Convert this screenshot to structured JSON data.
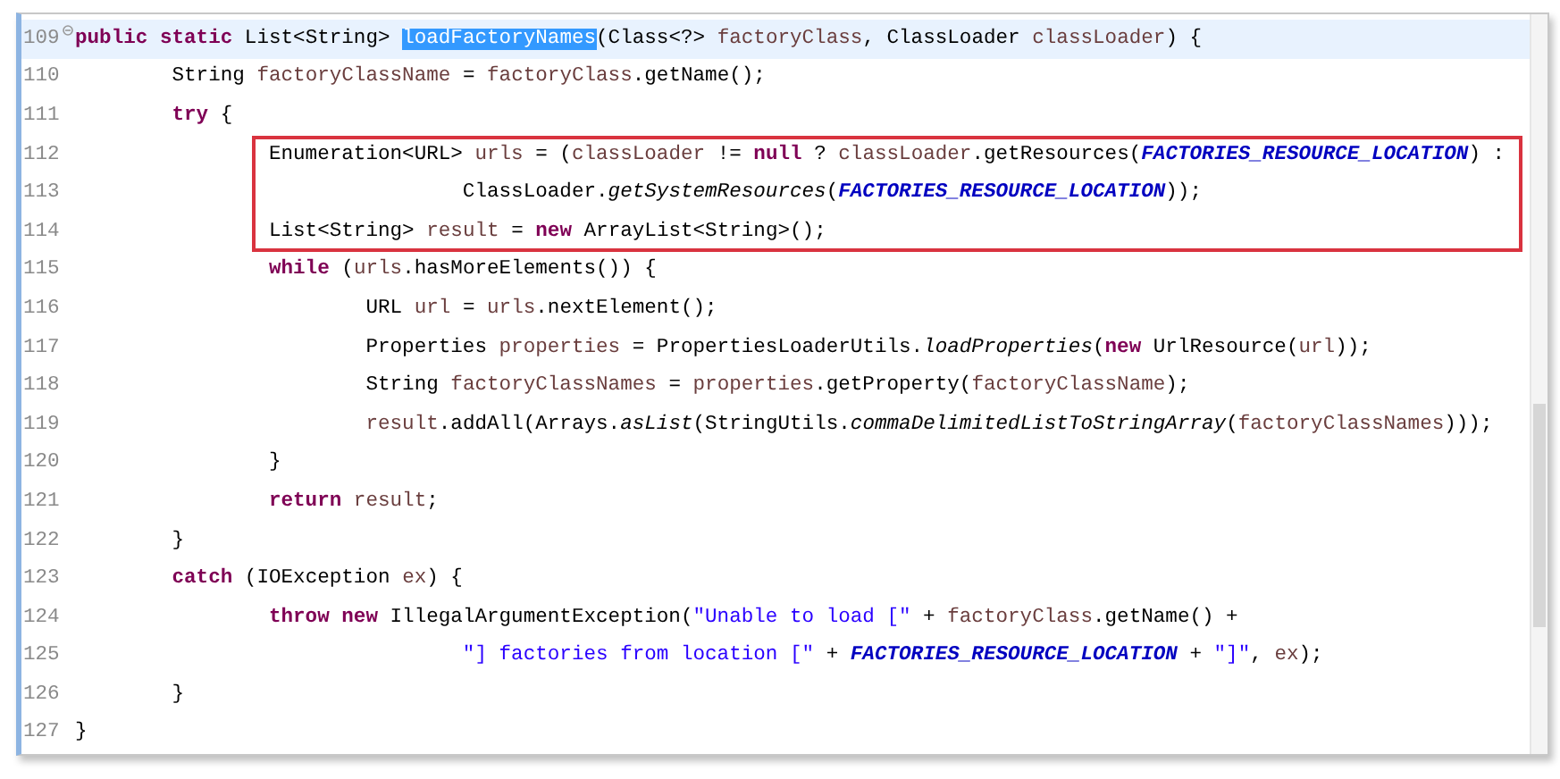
{
  "editor": {
    "lines": [
      {
        "number": "109",
        "current": true,
        "boxed": false,
        "fold": true,
        "tokens": [
          {
            "kind": "keyword",
            "text": "public static"
          },
          {
            "kind": "plain",
            "text": " List<String> "
          },
          {
            "kind": "selection",
            "text": "loadFactoryNames"
          },
          {
            "kind": "plain",
            "text": "(Class<?> "
          },
          {
            "kind": "variable",
            "text": "factoryClass"
          },
          {
            "kind": "plain",
            "text": ", ClassLoader "
          },
          {
            "kind": "variable",
            "text": "classLoader"
          },
          {
            "kind": "plain",
            "text": ") {"
          }
        ]
      },
      {
        "number": "110",
        "current": false,
        "boxed": false,
        "fold": false,
        "tokens": [
          {
            "kind": "plain",
            "text": "        String "
          },
          {
            "kind": "variable",
            "text": "factoryClassName"
          },
          {
            "kind": "plain",
            "text": " = "
          },
          {
            "kind": "variable",
            "text": "factoryClass"
          },
          {
            "kind": "plain",
            "text": ".getName();"
          }
        ]
      },
      {
        "number": "111",
        "current": false,
        "boxed": false,
        "fold": false,
        "tokens": [
          {
            "kind": "keyword",
            "text": "        try"
          },
          {
            "kind": "plain",
            "text": " {"
          }
        ]
      },
      {
        "number": "112",
        "current": false,
        "boxed": true,
        "fold": false,
        "tokens": [
          {
            "kind": "plain",
            "text": "                Enumeration<URL> "
          },
          {
            "kind": "variable",
            "text": "urls"
          },
          {
            "kind": "plain",
            "text": " = ("
          },
          {
            "kind": "variable",
            "text": "classLoader"
          },
          {
            "kind": "plain",
            "text": " != "
          },
          {
            "kind": "keyword",
            "text": "null"
          },
          {
            "kind": "plain",
            "text": " ? "
          },
          {
            "kind": "variable",
            "text": "classLoader"
          },
          {
            "kind": "plain",
            "text": ".getResources("
          },
          {
            "kind": "constant",
            "text": "FACTORIES_RESOURCE_LOCATION"
          },
          {
            "kind": "plain",
            "text": ") :"
          }
        ]
      },
      {
        "number": "113",
        "current": false,
        "boxed": true,
        "fold": false,
        "tokens": [
          {
            "kind": "plain",
            "text": "                                ClassLoader."
          },
          {
            "kind": "static",
            "text": "getSystemResources"
          },
          {
            "kind": "plain",
            "text": "("
          },
          {
            "kind": "constant",
            "text": "FACTORIES_RESOURCE_LOCATION"
          },
          {
            "kind": "plain",
            "text": "));"
          }
        ]
      },
      {
        "number": "114",
        "current": false,
        "boxed": true,
        "fold": false,
        "tokens": [
          {
            "kind": "plain",
            "text": "                List<String> "
          },
          {
            "kind": "variable",
            "text": "result"
          },
          {
            "kind": "plain",
            "text": " = "
          },
          {
            "kind": "keyword",
            "text": "new"
          },
          {
            "kind": "plain",
            "text": " ArrayList<String>();"
          }
        ]
      },
      {
        "number": "115",
        "current": false,
        "boxed": false,
        "fold": false,
        "tokens": [
          {
            "kind": "keyword",
            "text": "                while"
          },
          {
            "kind": "plain",
            "text": " ("
          },
          {
            "kind": "variable",
            "text": "urls"
          },
          {
            "kind": "plain",
            "text": ".hasMoreElements()) {"
          }
        ]
      },
      {
        "number": "116",
        "current": false,
        "boxed": false,
        "fold": false,
        "tokens": [
          {
            "kind": "plain",
            "text": "                        URL "
          },
          {
            "kind": "variable",
            "text": "url"
          },
          {
            "kind": "plain",
            "text": " = "
          },
          {
            "kind": "variable",
            "text": "urls"
          },
          {
            "kind": "plain",
            "text": ".nextElement();"
          }
        ]
      },
      {
        "number": "117",
        "current": false,
        "boxed": false,
        "fold": false,
        "tokens": [
          {
            "kind": "plain",
            "text": "                        Properties "
          },
          {
            "kind": "variable",
            "text": "properties"
          },
          {
            "kind": "plain",
            "text": " = PropertiesLoaderUtils."
          },
          {
            "kind": "static",
            "text": "loadProperties"
          },
          {
            "kind": "plain",
            "text": "("
          },
          {
            "kind": "keyword",
            "text": "new"
          },
          {
            "kind": "plain",
            "text": " UrlResource("
          },
          {
            "kind": "variable",
            "text": "url"
          },
          {
            "kind": "plain",
            "text": "));"
          }
        ]
      },
      {
        "number": "118",
        "current": false,
        "boxed": false,
        "fold": false,
        "tokens": [
          {
            "kind": "plain",
            "text": "                        String "
          },
          {
            "kind": "variable",
            "text": "factoryClassNames"
          },
          {
            "kind": "plain",
            "text": " = "
          },
          {
            "kind": "variable",
            "text": "properties"
          },
          {
            "kind": "plain",
            "text": ".getProperty("
          },
          {
            "kind": "variable",
            "text": "factoryClassName"
          },
          {
            "kind": "plain",
            "text": ");"
          }
        ]
      },
      {
        "number": "119",
        "current": false,
        "boxed": false,
        "fold": false,
        "tokens": [
          {
            "kind": "variable",
            "text": "                        result"
          },
          {
            "kind": "plain",
            "text": ".addAll(Arrays."
          },
          {
            "kind": "static",
            "text": "asList"
          },
          {
            "kind": "plain",
            "text": "(StringUtils."
          },
          {
            "kind": "static",
            "text": "commaDelimitedListToStringArray"
          },
          {
            "kind": "plain",
            "text": "("
          },
          {
            "kind": "variable",
            "text": "factoryClassNames"
          },
          {
            "kind": "plain",
            "text": ")));"
          }
        ]
      },
      {
        "number": "120",
        "current": false,
        "boxed": false,
        "fold": false,
        "tokens": [
          {
            "kind": "plain",
            "text": "                }"
          }
        ]
      },
      {
        "number": "121",
        "current": false,
        "boxed": false,
        "fold": false,
        "tokens": [
          {
            "kind": "keyword",
            "text": "                return"
          },
          {
            "kind": "variable",
            "text": " result"
          },
          {
            "kind": "plain",
            "text": ";"
          }
        ]
      },
      {
        "number": "122",
        "current": false,
        "boxed": false,
        "fold": false,
        "tokens": [
          {
            "kind": "plain",
            "text": "        }"
          }
        ]
      },
      {
        "number": "123",
        "current": false,
        "boxed": false,
        "fold": false,
        "tokens": [
          {
            "kind": "keyword",
            "text": "        catch"
          },
          {
            "kind": "plain",
            "text": " (IOException "
          },
          {
            "kind": "variable",
            "text": "ex"
          },
          {
            "kind": "plain",
            "text": ") {"
          }
        ]
      },
      {
        "number": "124",
        "current": false,
        "boxed": false,
        "fold": false,
        "tokens": [
          {
            "kind": "keyword",
            "text": "                throw new"
          },
          {
            "kind": "plain",
            "text": " IllegalArgumentException("
          },
          {
            "kind": "string",
            "text": "\"Unable to load [\""
          },
          {
            "kind": "plain",
            "text": " + "
          },
          {
            "kind": "variable",
            "text": "factoryClass"
          },
          {
            "kind": "plain",
            "text": ".getName() +"
          }
        ]
      },
      {
        "number": "125",
        "current": false,
        "boxed": false,
        "fold": false,
        "tokens": [
          {
            "kind": "string",
            "text": "                                \"] factories from location [\""
          },
          {
            "kind": "plain",
            "text": " + "
          },
          {
            "kind": "constant",
            "text": "FACTORIES_RESOURCE_LOCATION"
          },
          {
            "kind": "plain",
            "text": " + "
          },
          {
            "kind": "string",
            "text": "\"]\""
          },
          {
            "kind": "plain",
            "text": ", "
          },
          {
            "kind": "variable",
            "text": "ex"
          },
          {
            "kind": "plain",
            "text": ");"
          }
        ]
      },
      {
        "number": "126",
        "current": false,
        "boxed": false,
        "fold": false,
        "tokens": [
          {
            "kind": "plain",
            "text": "        }"
          }
        ]
      },
      {
        "number": "127",
        "current": false,
        "boxed": false,
        "fold": false,
        "tokens": [
          {
            "kind": "plain",
            "text": "}"
          }
        ]
      }
    ]
  }
}
